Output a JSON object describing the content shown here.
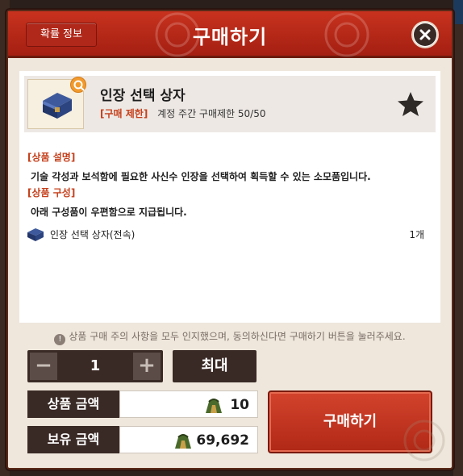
{
  "modal": {
    "title": "구매하기",
    "probability_button": "확률 정보",
    "close_icon": "close-icon"
  },
  "item": {
    "name": "인장 선택 상자",
    "limit_tag": "[구매 제한]",
    "limit_text": "계정 주간 구매제한 50/50",
    "icon": "blue-treasure-box-icon",
    "zoom_icon": "magnifier-icon",
    "favorite_icon": "star-icon"
  },
  "description": {
    "title": "[상품 설명]",
    "text": "기술 각성과 보석함에 필요한 사신수 인장을 선택하여 획득할 수 있는 소모품입니다."
  },
  "composition": {
    "title": "[상품 구성]",
    "text": "아래 구성품이 우편함으로 지급됩니다.",
    "items": [
      {
        "name": "인장 선택 상자(전속)",
        "qty": "1개",
        "icon": "blue-treasure-box-icon"
      }
    ]
  },
  "notice": "상품 구매 주의 사항을 모두 인지했으며, 동의하신다면 구매하기 버튼을 눌러주세요.",
  "quantity": {
    "value": "1",
    "minus": "−",
    "plus": "+",
    "max_label": "최대"
  },
  "price": {
    "label": "상품 금액",
    "value": "10",
    "currency_icon": "green-ingot-currency-icon"
  },
  "owned": {
    "label": "보유 금액",
    "value": "69,692",
    "currency_icon": "green-ingot-currency-icon"
  },
  "buy_button": "구매하기",
  "colors": {
    "header_red": "#b8281a",
    "dark_brown": "#3a2a26",
    "accent_orange": "#c5401c",
    "panel_bg": "#efe7dc"
  }
}
